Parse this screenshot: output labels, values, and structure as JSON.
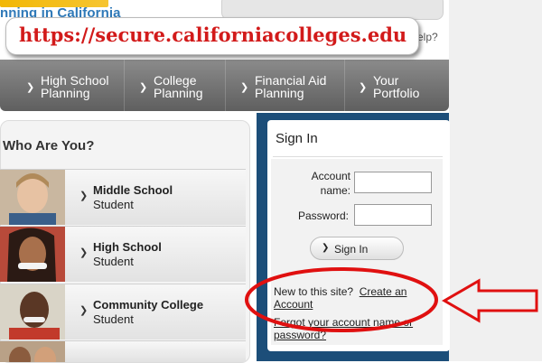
{
  "header": {
    "logo_sub": "nning in California",
    "help_fragment": "elp?"
  },
  "url_callout": {
    "text": "https://secure.californiacolleges.edu"
  },
  "nav": {
    "items": [
      {
        "line1": "High School",
        "line2": "Planning"
      },
      {
        "line1": "College",
        "line2": "Planning"
      },
      {
        "line1": "Financial Aid",
        "line2": "Planning"
      },
      {
        "line1": "Your",
        "line2": "Portfolio"
      }
    ]
  },
  "who": {
    "title": "Who Are You?",
    "rows": [
      {
        "line1": "Middle School",
        "line2": "Student"
      },
      {
        "line1": "High School",
        "line2": "Student"
      },
      {
        "line1": "Community College",
        "line2": "Student"
      }
    ]
  },
  "signin": {
    "title": "Sign In",
    "account_label_1": "Account",
    "account_label_2": "name:",
    "password_label": "Password:",
    "button_label": "Sign In",
    "new_prefix": "New to this site?",
    "create_1": "Create an",
    "create_2": "Account",
    "forgot_1": "Forgot your account name or",
    "forgot_2": "password?"
  },
  "colors": {
    "url_red": "#d21a1a",
    "nav_gray": "#6f6f6f",
    "signin_blue": "#1c4e79",
    "annotation_red": "#e01010"
  }
}
